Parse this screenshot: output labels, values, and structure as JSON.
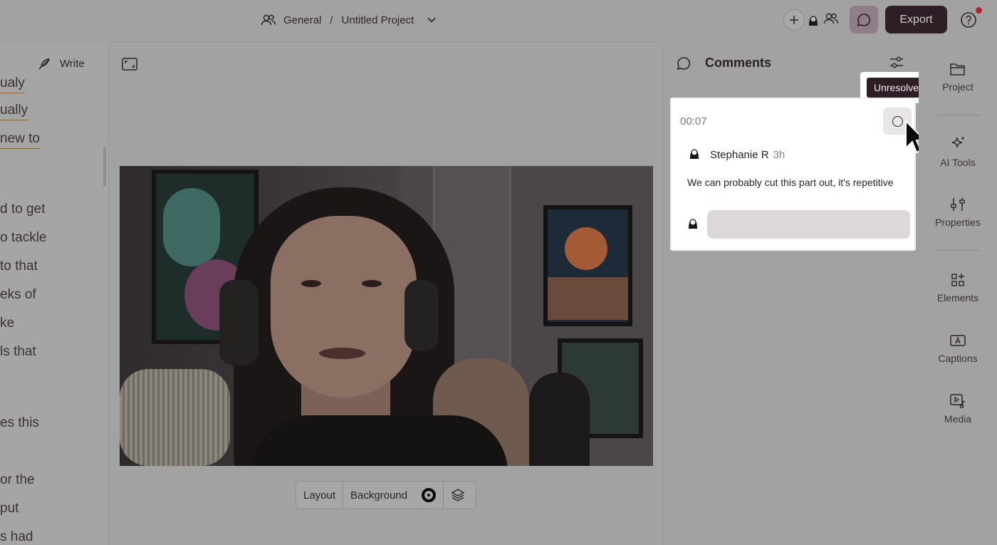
{
  "header": {
    "workspace": "General",
    "separator": "/",
    "project": "Untitled Project",
    "export_label": "Export",
    "accent": "#2e1f26",
    "notification_color": "#b3202c"
  },
  "script_panel": {
    "write_label": "Write",
    "lines": [
      {
        "text": "ualy",
        "underlined": true
      },
      {
        "text": "ually",
        "underlined": true
      },
      {
        "text": "new to",
        "underlined": true
      },
      {
        "text": "d to get",
        "underlined": false
      },
      {
        "text": "o tackle",
        "underlined": false
      },
      {
        "text": " to that",
        "underlined": false
      },
      {
        "text": "eks of",
        "underlined": false
      },
      {
        "text": "ke",
        "underlined": false
      },
      {
        "text": "ls that",
        "underlined": false
      },
      {
        "text": "es this",
        "underlined": false
      },
      {
        "text": "or the",
        "underlined": false
      },
      {
        "text": " put",
        "underlined": false
      },
      {
        "text": "s had",
        "underlined": false
      }
    ]
  },
  "canvas": {
    "toolbar": {
      "layout_label": "Layout",
      "background_label": "Background",
      "background_color": "#0d0b0c"
    }
  },
  "comments": {
    "title": "Comments",
    "tooltip": "Unresolve",
    "items": [
      {
        "timestamp": "00:07",
        "author": "Stephanie R",
        "ago": "3h",
        "body": "We can probably cut this part out, it's repetitive",
        "reply_placeholder": ""
      }
    ]
  },
  "rail": {
    "items": [
      {
        "label": "Project",
        "icon": "folder-icon"
      },
      {
        "label": "AI Tools",
        "icon": "sparkle-icon"
      },
      {
        "label": "Properties",
        "icon": "sliders-icon"
      },
      {
        "label": "Elements",
        "icon": "shapes-icon"
      },
      {
        "label": "Captions",
        "icon": "captions-icon"
      },
      {
        "label": "Media",
        "icon": "media-icon"
      }
    ]
  }
}
